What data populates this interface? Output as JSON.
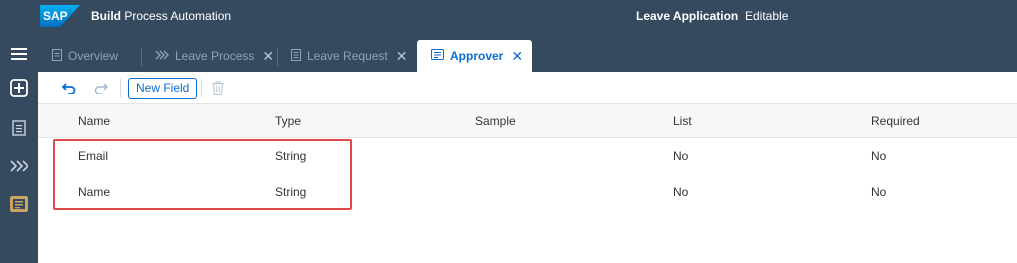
{
  "header": {
    "logo": "SAP",
    "app_name_bold": "Build",
    "app_name_rest": "Process Automation",
    "document_title": "Leave Application",
    "document_state": "Editable"
  },
  "rail": {
    "items": [
      {
        "icon": "hamburger-menu-icon"
      },
      {
        "icon": "add-icon"
      },
      {
        "icon": "document-icon"
      },
      {
        "icon": "process-chevron-icon"
      },
      {
        "icon": "data-type-icon",
        "active": true
      }
    ]
  },
  "tabs": [
    {
      "label": "Overview",
      "icon": "document-icon",
      "closable": false
    },
    {
      "label": "Leave Process",
      "icon": "process-chevron-icon",
      "closable": true
    },
    {
      "label": "Leave Request",
      "icon": "form-icon",
      "closable": true
    },
    {
      "label": "Approver",
      "icon": "data-type-icon",
      "closable": true,
      "active": true
    }
  ],
  "toolbar": {
    "undo_icon": "undo-icon",
    "redo_icon": "redo-icon",
    "new_field_label": "New Field",
    "delete_icon": "delete-icon"
  },
  "table": {
    "columns": [
      "Name",
      "Type",
      "Sample",
      "List",
      "Required"
    ],
    "rows": [
      {
        "name": "Email",
        "type": "String",
        "sample": "",
        "list": "No",
        "required": "No"
      },
      {
        "name": "Name",
        "type": "String",
        "sample": "",
        "list": "No",
        "required": "No"
      }
    ]
  },
  "colors": {
    "shell": "#354a5f",
    "accent": "#0a6ed1",
    "highlight": "#e0484b",
    "active_rail_icon": "#c9a463"
  }
}
